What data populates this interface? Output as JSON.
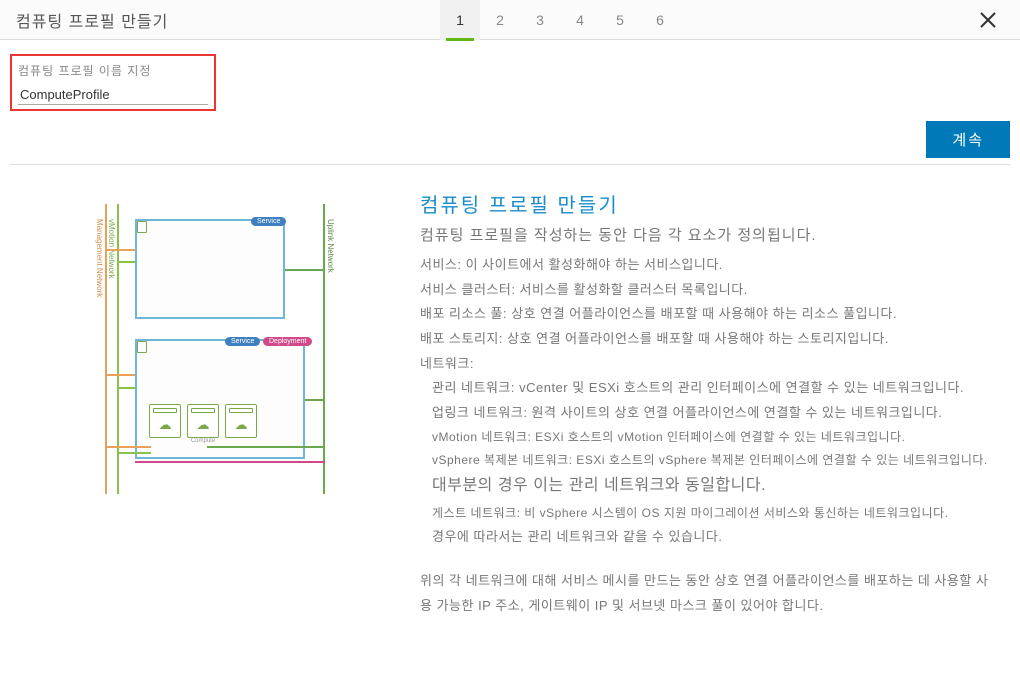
{
  "header": {
    "title": "컴퓨팅 프로필 만들기",
    "steps": [
      "1",
      "2",
      "3",
      "4",
      "5",
      "6"
    ],
    "active_step": 0
  },
  "form": {
    "name_label": "컴퓨팅 프로필 이름 지정",
    "name_value": "ComputeProfile",
    "continue_label": "계속"
  },
  "diagram": {
    "left_label_1": "Management Network",
    "left_label_2": "vMotion Network",
    "right_label": "Uplink Network",
    "badge_service": "Service",
    "badge_deployment": "Deployment",
    "host_label": "Compute"
  },
  "content": {
    "title": "컴퓨팅 프로필 만들기",
    "subtitle": "컴퓨팅 프로필을 작성하는 동안 다음 각 요소가 정의됩니다.",
    "lines": [
      "서비스: 이 사이트에서 활성화해야 하는 서비스입니다.",
      "서비스 클러스터: 서비스를 활성화할 클러스터 목록입니다.",
      "배포 리소스 풀: 상호 연결 어플라이언스를 배포할 때 사용해야 하는 리소스 풀입니다.",
      "배포 스토리지: 상호 연결 어플라이언스를 배포할 때 사용해야 하는 스토리지입니다.",
      "네트워크:"
    ],
    "network_lines": [
      "관리 네트워크: vCenter 및 ESXi 호스트의 관리 인터페이스에 연결할 수 있는 네트워크입니다.",
      "업링크 네트워크: 원격 사이트의 상호 연결 어플라이언스에 연결할 수 있는 네트워크입니다.",
      "vMotion 네트워크: ESXi 호스트의 vMotion 인터페이스에 연결할 수 있는 네트워크입니다.",
      "vSphere 복제본 네트워크: ESXi 호스트의 vSphere 복제본 인터페이스에 연결할 수 있는 네트워크입니다.",
      "대부분의 경우 이는 관리 네트워크와 동일합니다.",
      "게스트 네트워크: 비 vSphere 시스템이 OS 지원 마이그레이션 서비스와 통신하는 네트워크입니다.",
      "경우에 따라서는 관리 네트워크와 같을 수 있습니다."
    ],
    "footer": "위의 각 네트워크에 대해 서비스 메시를 만드는 동안 상호 연결 어플라이언스를 배포하는 데 사용할 사용 가능한 IP 주소, 게이트웨이 IP 및 서브넷 마스크 풀이 있어야 합니다."
  }
}
